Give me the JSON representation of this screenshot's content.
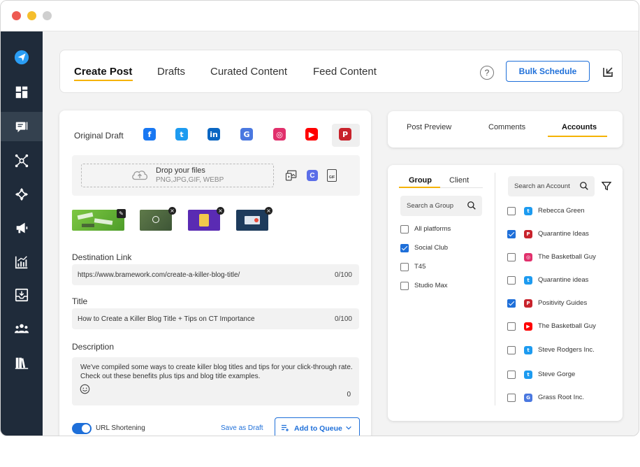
{
  "top_tabs": [
    {
      "label": "Create Post"
    },
    {
      "label": "Drafts"
    },
    {
      "label": "Curated Content"
    },
    {
      "label": "Feed Content"
    }
  ],
  "help_label": "?",
  "bulk_schedule_label": "Bulk Schedule",
  "sidebar_icons": [
    "send-logo-icon",
    "dashboard-icon",
    "posts-icon",
    "network-icon",
    "move-icon",
    "megaphone-icon",
    "analytics-icon",
    "inbox-icon",
    "team-icon",
    "library-icon"
  ],
  "editor": {
    "original_draft_label": "Original Draft",
    "platforms": [
      {
        "name": "facebook",
        "glyph": "f",
        "color": "#1877f2"
      },
      {
        "name": "twitter",
        "glyph": "t",
        "color": "#1d9bf0"
      },
      {
        "name": "linkedin",
        "glyph": "in",
        "color": "#0a66c2"
      },
      {
        "name": "google-business",
        "glyph": "G",
        "color": "#4a78e0"
      },
      {
        "name": "instagram",
        "glyph": "◎",
        "color": "#e1306c"
      },
      {
        "name": "youtube",
        "glyph": "▶",
        "color": "#ff0000"
      },
      {
        "name": "pinterest",
        "glyph": "P",
        "color": "#c8232c"
      }
    ],
    "drop_title": "Drop your files",
    "drop_formats": "PNG,JPG,GIF, WEBP",
    "canva_glyph": "C",
    "gif_glyph": "GIF",
    "destination_label": "Destination Link",
    "destination_value": "https://www.bramework.com/create-a-killer-blog-title/",
    "destination_count": "0/100",
    "title_label": "Title",
    "title_value": "How to Create a Killer Blog Title + Tips on CT Importance",
    "title_count": "0/100",
    "description_label": "Description",
    "description_value": "We've compiled some ways to create killer blog titles and tips for your click-through rate. Check out these benefits plus tips and blog title examples.",
    "description_count": "0",
    "url_shortening_label": "URL Shortening",
    "url_shortening_on": true,
    "save_draft_label": "Save as Draft",
    "add_queue_label": "Add to Queue"
  },
  "preview_tabs": [
    {
      "label": "Post Preview"
    },
    {
      "label": "Comments"
    },
    {
      "label": "Accounts"
    }
  ],
  "accounts_panel": {
    "group_tab": "Group",
    "client_tab": "Client",
    "search_group_placeholder": "Search a Group",
    "search_account_placeholder": "Search an Account",
    "groups": [
      {
        "label": "All platforms",
        "checked": false
      },
      {
        "label": "Social Club",
        "checked": true
      },
      {
        "label": "T45",
        "checked": false
      },
      {
        "label": "Studio Max",
        "checked": false
      }
    ],
    "accounts": [
      {
        "label": "Rebecca Green",
        "platform": "twitter",
        "checked": false
      },
      {
        "label": "Quarantine Ideas",
        "platform": "pinterest",
        "checked": true
      },
      {
        "label": "The Basketball Guy",
        "platform": "instagram",
        "checked": false
      },
      {
        "label": "Quarantine ideas",
        "platform": "twitter",
        "checked": false
      },
      {
        "label": "Positivity Guides",
        "platform": "pinterest",
        "checked": true
      },
      {
        "label": "The Basketball Guy",
        "platform": "youtube",
        "checked": false
      },
      {
        "label": "Steve Rodgers Inc.",
        "platform": "twitter",
        "checked": false
      },
      {
        "label": "Steve Gorge",
        "platform": "twitter",
        "checked": false
      },
      {
        "label": "Grass Root Inc.",
        "platform": "google-business",
        "checked": false
      }
    ]
  },
  "colors": {
    "accent": "#1e6fd9",
    "tab_underline": "#f5b300",
    "sidebar": "#1f2b3a"
  }
}
